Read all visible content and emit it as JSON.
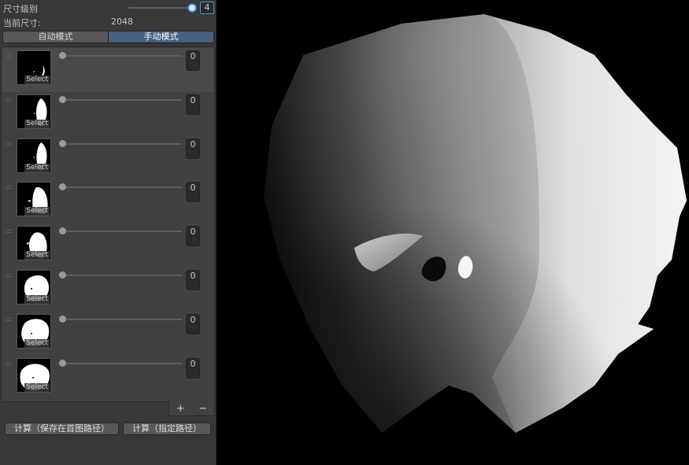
{
  "panel": {
    "size_level": {
      "label": "尺寸级别",
      "value": "4",
      "slider_fraction": 0.97
    },
    "current_size": {
      "label": "当前尺寸:",
      "value": "2048"
    },
    "mode_tabs": {
      "auto": "自动模式",
      "manual": "手动模式",
      "selected": "manual"
    },
    "items": [
      {
        "value": "0",
        "thumb_label": "Select",
        "slider_fraction": 0
      },
      {
        "value": "0",
        "thumb_label": "Select",
        "slider_fraction": 0
      },
      {
        "value": "0",
        "thumb_label": "Select",
        "slider_fraction": 0
      },
      {
        "value": "0",
        "thumb_label": "Select",
        "slider_fraction": 0
      },
      {
        "value": "0",
        "thumb_label": "Select",
        "slider_fraction": 0
      },
      {
        "value": "0",
        "thumb_label": "Select",
        "slider_fraction": 0
      },
      {
        "value": "0",
        "thumb_label": "Select",
        "slider_fraction": 0
      },
      {
        "value": "0",
        "thumb_label": "Select",
        "slider_fraction": 0
      }
    ],
    "footer": {
      "add": "+",
      "remove": "−"
    },
    "buttons": {
      "compute_save": "计算（保存在首图路径）",
      "compute_path": "计算（指定路径）"
    }
  },
  "colors": {
    "accent": "#3b7fd1",
    "selected_tab": "#46607f",
    "panel_bg": "#383838"
  }
}
